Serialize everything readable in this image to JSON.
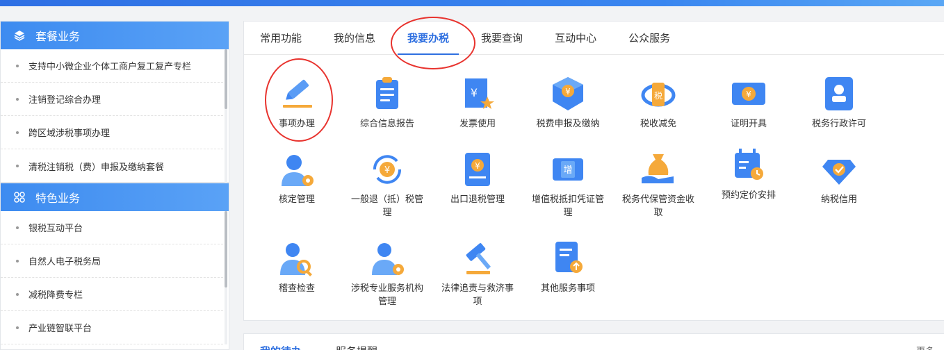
{
  "sidebar": {
    "sections": [
      {
        "title": "套餐业务",
        "icon": "layers-icon",
        "items": [
          "支持中小微企业个体工商户复工复产专栏",
          "注销登记综合办理",
          "跨区域涉税事项办理",
          "清税注销税（费）申报及缴纳套餐"
        ]
      },
      {
        "title": "特色业务",
        "icon": "grid-icon",
        "items": [
          "银税互动平台",
          "自然人电子税务局",
          "减税降费专栏",
          "产业链智联平台"
        ]
      }
    ]
  },
  "main": {
    "tabs": [
      "常用功能",
      "我的信息",
      "我要办税",
      "我要查询",
      "互动中心",
      "公众服务"
    ],
    "active_tab": "我要办税",
    "services": [
      {
        "label": "事项办理",
        "icon": "pen-icon"
      },
      {
        "label": "综合信息报告",
        "icon": "clipboard-icon"
      },
      {
        "label": "发票使用",
        "icon": "invoice-icon"
      },
      {
        "label": "税费申报及缴纳",
        "icon": "tax-declare-icon"
      },
      {
        "label": "税收减免",
        "icon": "tax-reduce-icon"
      },
      {
        "label": "证明开具",
        "icon": "certificate-icon"
      },
      {
        "label": "税务行政许可",
        "icon": "license-icon"
      },
      {
        "label": "核定管理",
        "icon": "user-gear-icon"
      },
      {
        "label": "一般退（抵）税管理",
        "icon": "refund-icon"
      },
      {
        "label": "出口退税管理",
        "icon": "export-refund-icon"
      },
      {
        "label": "增值税抵扣凭证管理",
        "icon": "vat-voucher-icon"
      },
      {
        "label": "税务代保管资金收取",
        "icon": "money-bag-icon"
      },
      {
        "label": "预约定价安排",
        "icon": "calendar-clock-icon"
      },
      {
        "label": "纳税信用",
        "icon": "diamond-credit-icon"
      },
      {
        "label": "稽查检查",
        "icon": "inspector-icon"
      },
      {
        "label": "涉税专业服务机构管理",
        "icon": "agent-gear-icon"
      },
      {
        "label": "法律追责与救济事项",
        "icon": "gavel-icon"
      },
      {
        "label": "其他服务事项",
        "icon": "document-upload-icon"
      }
    ]
  },
  "bottom": {
    "tabs": [
      "我的待办",
      "服务提醒"
    ],
    "more": "更多"
  },
  "colors": {
    "primary": "#2e6fe0",
    "icon_blue": "#3f86f2",
    "icon_orange": "#f5a93a",
    "highlight_ring": "#e8332e"
  }
}
